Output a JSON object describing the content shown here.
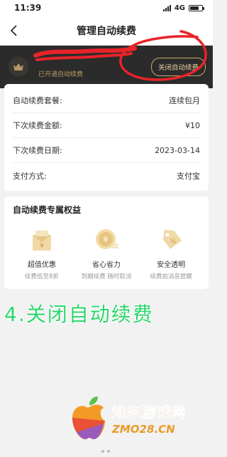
{
  "status_bar": {
    "time": "11:39",
    "network": "4G",
    "battery_level": 0.75
  },
  "nav": {
    "title": "管理自动续费",
    "back_icon": "chevron-left-icon"
  },
  "vip": {
    "name": "",
    "status": "已开通自动续费",
    "close_button": "关闭自动续费",
    "crown_icon": "crown-icon",
    "bg_color": "#2b2b2b",
    "accent_color": "#d9b97a",
    "scribble_color": "#e8232a"
  },
  "info": {
    "rows": [
      {
        "label": "自动续费套餐:",
        "value": "连续包月"
      },
      {
        "label": "下次续费金额:",
        "value": "¥10"
      },
      {
        "label": "下次续费日期:",
        "value": "2023-03-14"
      },
      {
        "label": "支付方式:",
        "value": "支付宝"
      }
    ]
  },
  "benefits": {
    "title": "自动续费专属权益",
    "items": [
      {
        "icon": "gift-icon",
        "name": "超值优惠",
        "desc": "续费低至8折"
      },
      {
        "icon": "coin-icon",
        "name": "省心省力",
        "desc": "到期续费 随时取消"
      },
      {
        "icon": "tag-icon",
        "name": "安全透明",
        "desc": "续费前消息提醒"
      }
    ]
  },
  "overlay": {
    "caption": "4.关闭自动续费",
    "caption_color": "#2bd66a"
  },
  "watermark": {
    "name": "知末游戏网",
    "url": "ZMO28.CN",
    "color": "#e89b2a"
  }
}
